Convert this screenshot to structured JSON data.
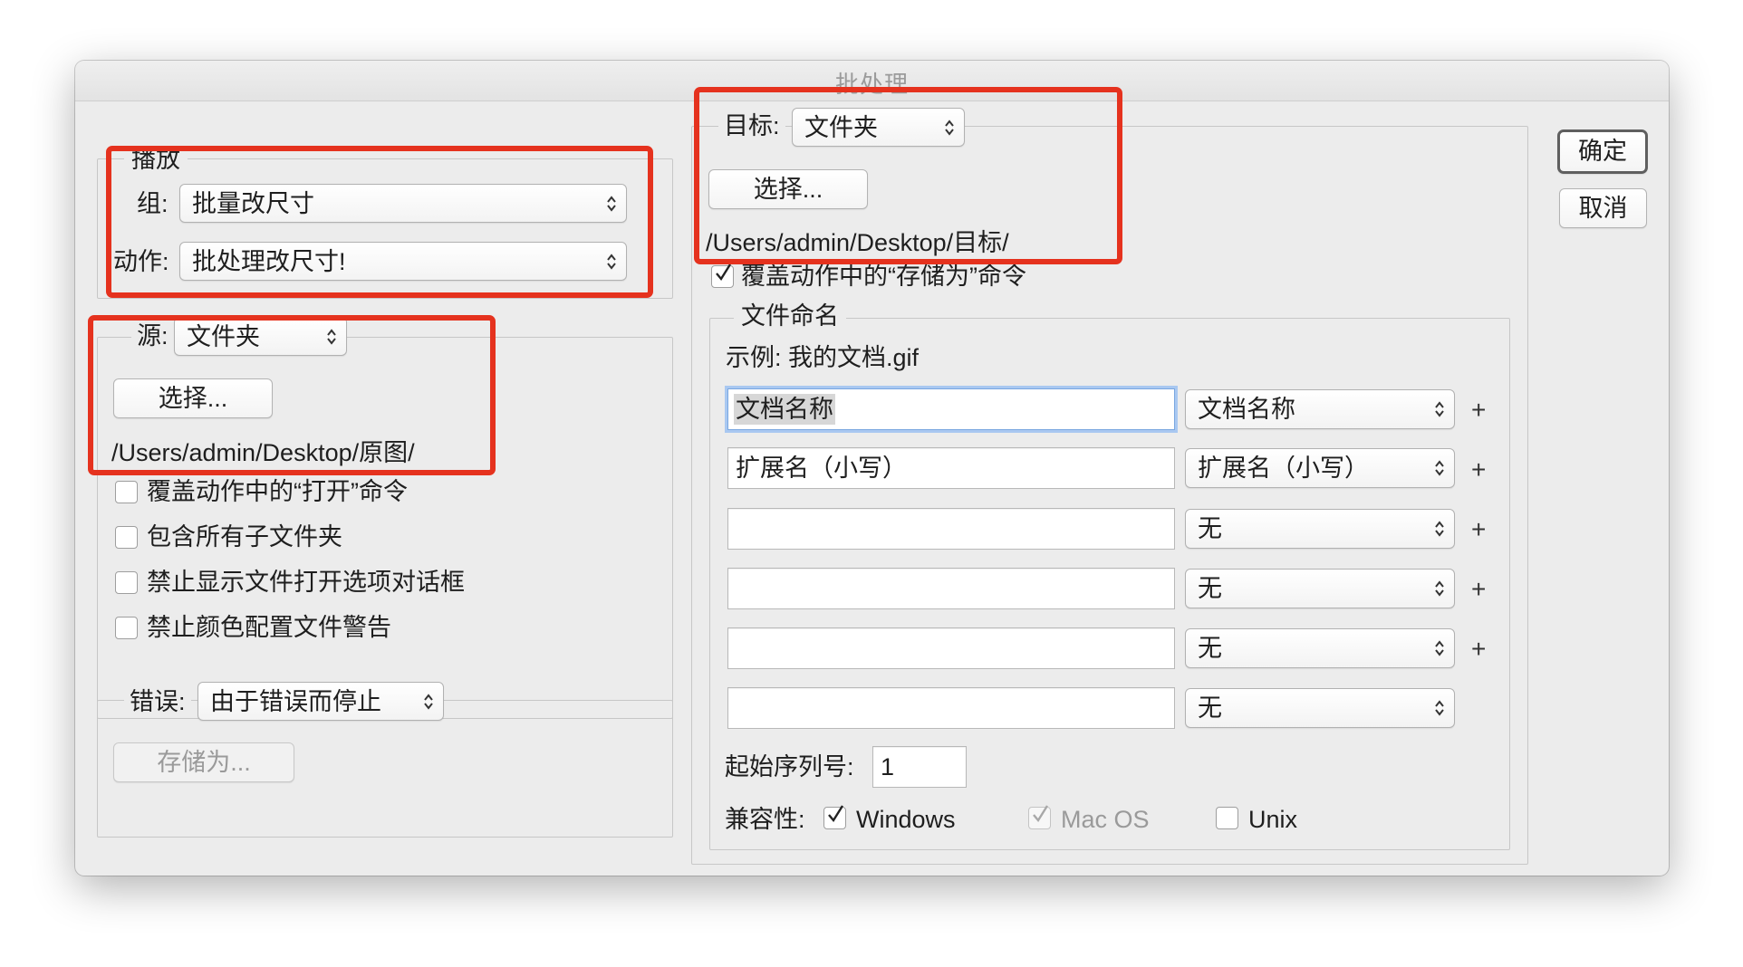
{
  "dialog": {
    "title": "批处理"
  },
  "buttons": {
    "ok": "确定",
    "cancel": "取消"
  },
  "play": {
    "legend": "播放",
    "set_label": "组:",
    "set_value": "批量改尺寸",
    "action_label": "动作:",
    "action_value": "批处理改尺寸!"
  },
  "source": {
    "label": "源:",
    "value": "文件夹",
    "choose_button": "选择...",
    "path": "/Users/admin/Desktop/原图/",
    "options": [
      {
        "label": "覆盖动作中的“打开”命令",
        "checked": false
      },
      {
        "label": "包含所有子文件夹",
        "checked": false
      },
      {
        "label": "禁止显示文件打开选项对话框",
        "checked": false
      },
      {
        "label": "禁止颜色配置文件警告",
        "checked": false
      }
    ]
  },
  "errors": {
    "label": "错误:",
    "value": "由于错误而停止",
    "save_as_button": "存储为..."
  },
  "destination": {
    "label": "目标:",
    "value": "文件夹",
    "choose_button": "选择...",
    "path": "/Users/admin/Desktop/目标/",
    "override_save_as": {
      "label": "覆盖动作中的“存储为”命令",
      "checked": true
    }
  },
  "file_naming": {
    "legend": "文件命名",
    "example": "示例: 我的文档.gif",
    "rows": [
      {
        "field": "文档名称",
        "select": "文档名称",
        "plus": "+"
      },
      {
        "field": "扩展名（小写）",
        "select": "扩展名（小写）",
        "plus": "+"
      },
      {
        "field": "",
        "select": "无",
        "plus": "+"
      },
      {
        "field": "",
        "select": "无",
        "plus": "+"
      },
      {
        "field": "",
        "select": "无",
        "plus": "+"
      },
      {
        "field": "",
        "select": "无",
        "plus": ""
      }
    ],
    "start_serial_label": "起始序列号:",
    "start_serial_value": "1",
    "compat_label": "兼容性:",
    "compat": [
      {
        "label": "Windows",
        "checked": true,
        "enabled": true
      },
      {
        "label": "Mac OS",
        "checked": true,
        "enabled": false
      },
      {
        "label": "Unix",
        "checked": false,
        "enabled": true
      }
    ]
  },
  "colors": {
    "annotation": "#e5321e",
    "focus_ring": "#a9c8f1"
  }
}
